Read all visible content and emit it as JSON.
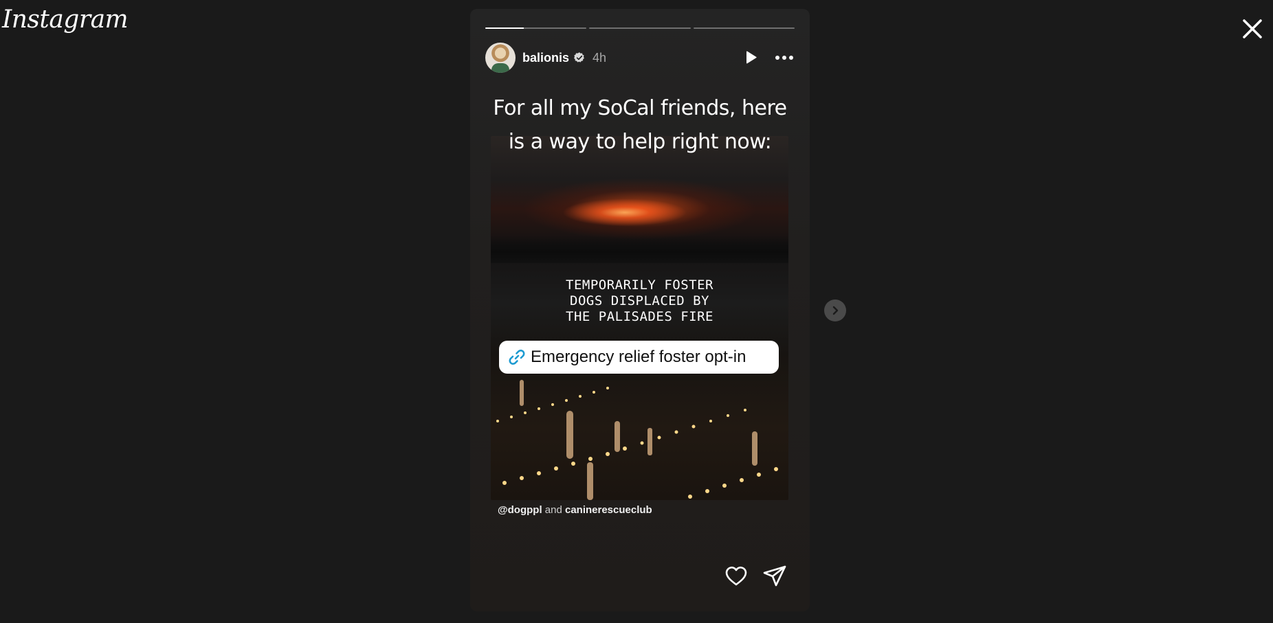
{
  "app": {
    "logo_text": "Instagram"
  },
  "story": {
    "progress": {
      "segments": 3,
      "current_index": 0,
      "current_fill_percent": 38
    },
    "header": {
      "username": "balionis",
      "verified": true,
      "timestamp": "4h"
    },
    "caption": "For all my SoCal friends, here is a way to help right now:",
    "overlay_text": "TEMPORARILY FOSTER\nDOGS DISPLACED BY\nTHE PALISADES FIRE",
    "link_sticker": {
      "label": "Emergency relief foster opt-in",
      "icon": "link-icon",
      "icon_color": "#1d9bd1"
    },
    "mentions": {
      "first": "@dogppl",
      "separator": "and",
      "second": "caninerescueclub"
    }
  },
  "icons": {
    "close": "close-icon",
    "play": "play-icon",
    "more": "more-icon",
    "like": "heart-icon",
    "share": "send-icon",
    "next": "chevron-right-icon",
    "verified": "verified-badge-icon"
  },
  "colors": {
    "background": "#1a1a1a",
    "story_card": "#232120",
    "muted_text": "#a8a8a8",
    "link_accent": "#1d9bd1"
  }
}
